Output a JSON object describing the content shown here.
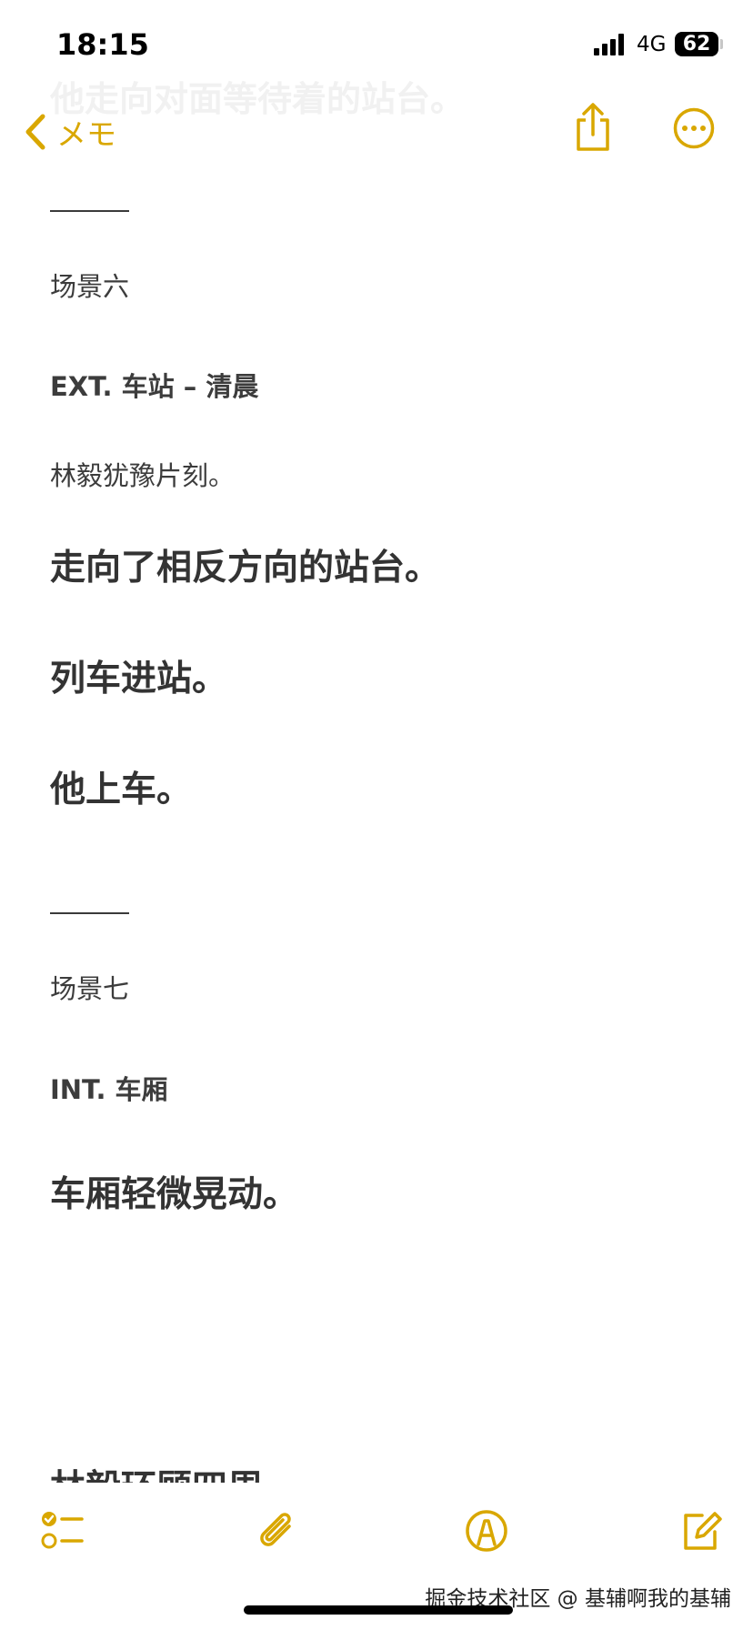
{
  "status": {
    "time": "18:15",
    "network": "4G",
    "battery": "62"
  },
  "nav": {
    "back_label": "メモ"
  },
  "ghost_text": "他走向对面等待着的站台。",
  "note": {
    "scene6_label": "场景六",
    "scene6_heading": "EXT. 车站 – 清晨",
    "line1": "林毅犹豫片刻。",
    "line2": "走向了相反方向的站台。",
    "line3": "列车进站。",
    "line4": "他上车。",
    "scene7_label": "场景七",
    "scene7_heading": "INT. 车厢",
    "line5": "车厢轻微晃动。",
    "line6": "林毅环顾四周。"
  },
  "watermark": "掘金技术社区 @ 基辅啊我的基辅",
  "colors": {
    "accent": "#d9a700",
    "text": "#3a3a3a",
    "background": "#ffffff"
  },
  "icons": {
    "back": "chevron-left-icon",
    "share": "share-icon",
    "more": "ellipsis-circle-icon",
    "checklist": "checklist-icon",
    "attach": "paperclip-icon",
    "markup": "pen-circle-icon",
    "compose": "compose-icon"
  }
}
